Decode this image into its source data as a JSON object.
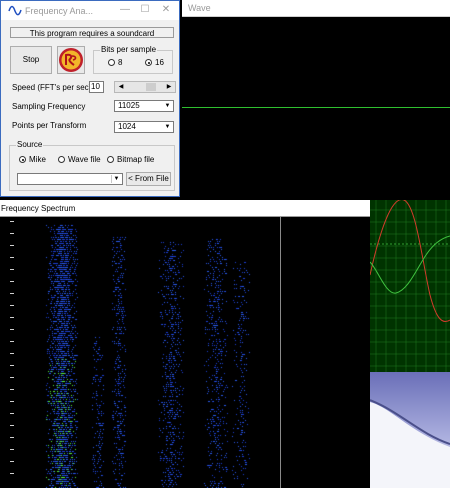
{
  "dialog": {
    "title": "Frequency Ana...",
    "controls": {
      "minimize": "—",
      "maximize": "☐",
      "close": "✕"
    },
    "notice": "This program requires a soundcard",
    "stop_label": "Stop",
    "bits_per_sample": {
      "label": "Bits per sample",
      "options": [
        "8",
        "16"
      ],
      "selected": "16"
    },
    "speed": {
      "label": "Speed (FFT's per sec)",
      "value": "10"
    },
    "sampling_frequency": {
      "label": "Sampling Frequency",
      "value": "11025"
    },
    "points_per_transform": {
      "label": "Points per Transform",
      "value": "1024"
    },
    "source": {
      "label": "Source",
      "options": [
        "Mike",
        "Wave file",
        "Bitmap file"
      ],
      "selected": "Mike",
      "file_value": "",
      "from_file_label": "< From File"
    }
  },
  "wave_window": {
    "title": "Wave"
  },
  "spectrum_window": {
    "title": "Frequency Spectrum"
  },
  "colors": {
    "accent_border": "#3b6bbf",
    "trace_green": "#2fbf2f",
    "trace_red": "#c0392b",
    "spectrum_blue": "#1d3fd8",
    "spectrum_green": "#59f03a"
  }
}
